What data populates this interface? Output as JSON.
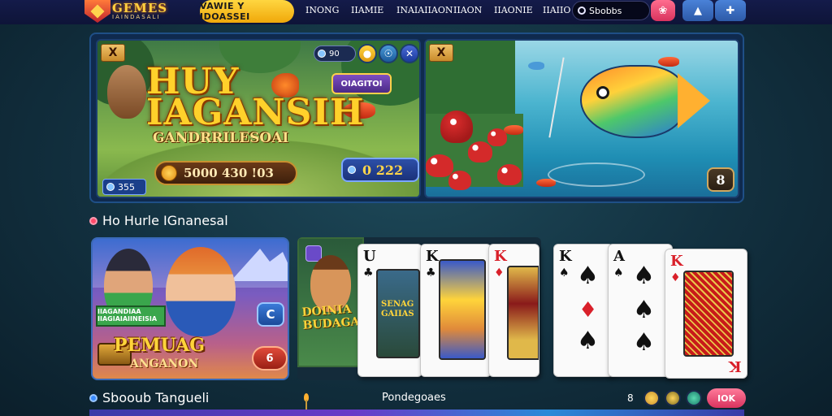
{
  "nav": {
    "logo_title": "GEMES",
    "logo_sub": "IAINDASALI",
    "main_pill": "VAWIE Y IDOASSEI",
    "links": [
      "INONG",
      "IIAMIE",
      "INAIAIIAON",
      "IIAON",
      "IIAONIE",
      "IIAIIO"
    ],
    "search_value": "Sbobbs",
    "search_placeholder": "Search",
    "pink_icon": "settings-icon",
    "blue_icons": [
      "cup-icon",
      "puzzle-icon"
    ]
  },
  "hero": {
    "left": {
      "close_tag": "X",
      "title_line1": "HUY",
      "title_line2": "IAGANSIH",
      "subtitle": "GANDRRILESOAI",
      "coin_amount": "5000 430 !03",
      "small_badge": "355",
      "bet_pill": "90",
      "purple_button": "OIAGITOI",
      "score_value": "0 222"
    },
    "right": {
      "close_tag": "X",
      "corner_button": "8"
    }
  },
  "sections": [
    {
      "title": "Ho Hurle IGnanesal",
      "dot_color": "#ff4a6a"
    },
    {
      "title": "Sbooub Tangueli",
      "dot_color": "#3a8cff"
    }
  ],
  "game_a": {
    "tag": "IIAGANDIAA IIAGIAIAIINEISIA",
    "title": "PEMUAG",
    "subtitle": "ANGANON",
    "btn_c": "C",
    "btn_r": "6"
  },
  "game_b": {
    "title_line1": "DOINIA",
    "title_line2": "BUDAGAN",
    "art_title": "SENAG GAIIAS"
  },
  "cards": [
    {
      "rank": "U",
      "suit": "♣",
      "color": "black"
    },
    {
      "rank": "K",
      "suit": "♣",
      "color": "black"
    },
    {
      "rank": "K",
      "suit": "♦",
      "color": "red"
    },
    {
      "rank": "K",
      "suit": "♠",
      "color": "black"
    },
    {
      "rank": "A",
      "suit": "♠",
      "color": "black"
    },
    {
      "rank": "K",
      "suit": "♦",
      "color": "red"
    }
  ],
  "bottom": {
    "mid_label": "Pondegoaes",
    "chip_label": "8",
    "pink_button": "IOK"
  },
  "colors": {
    "nav_bg": "#141b4a",
    "accent_yellow": "#ffd640",
    "accent_pink": "#ff6d8f",
    "accent_blue": "#4a82d8"
  }
}
